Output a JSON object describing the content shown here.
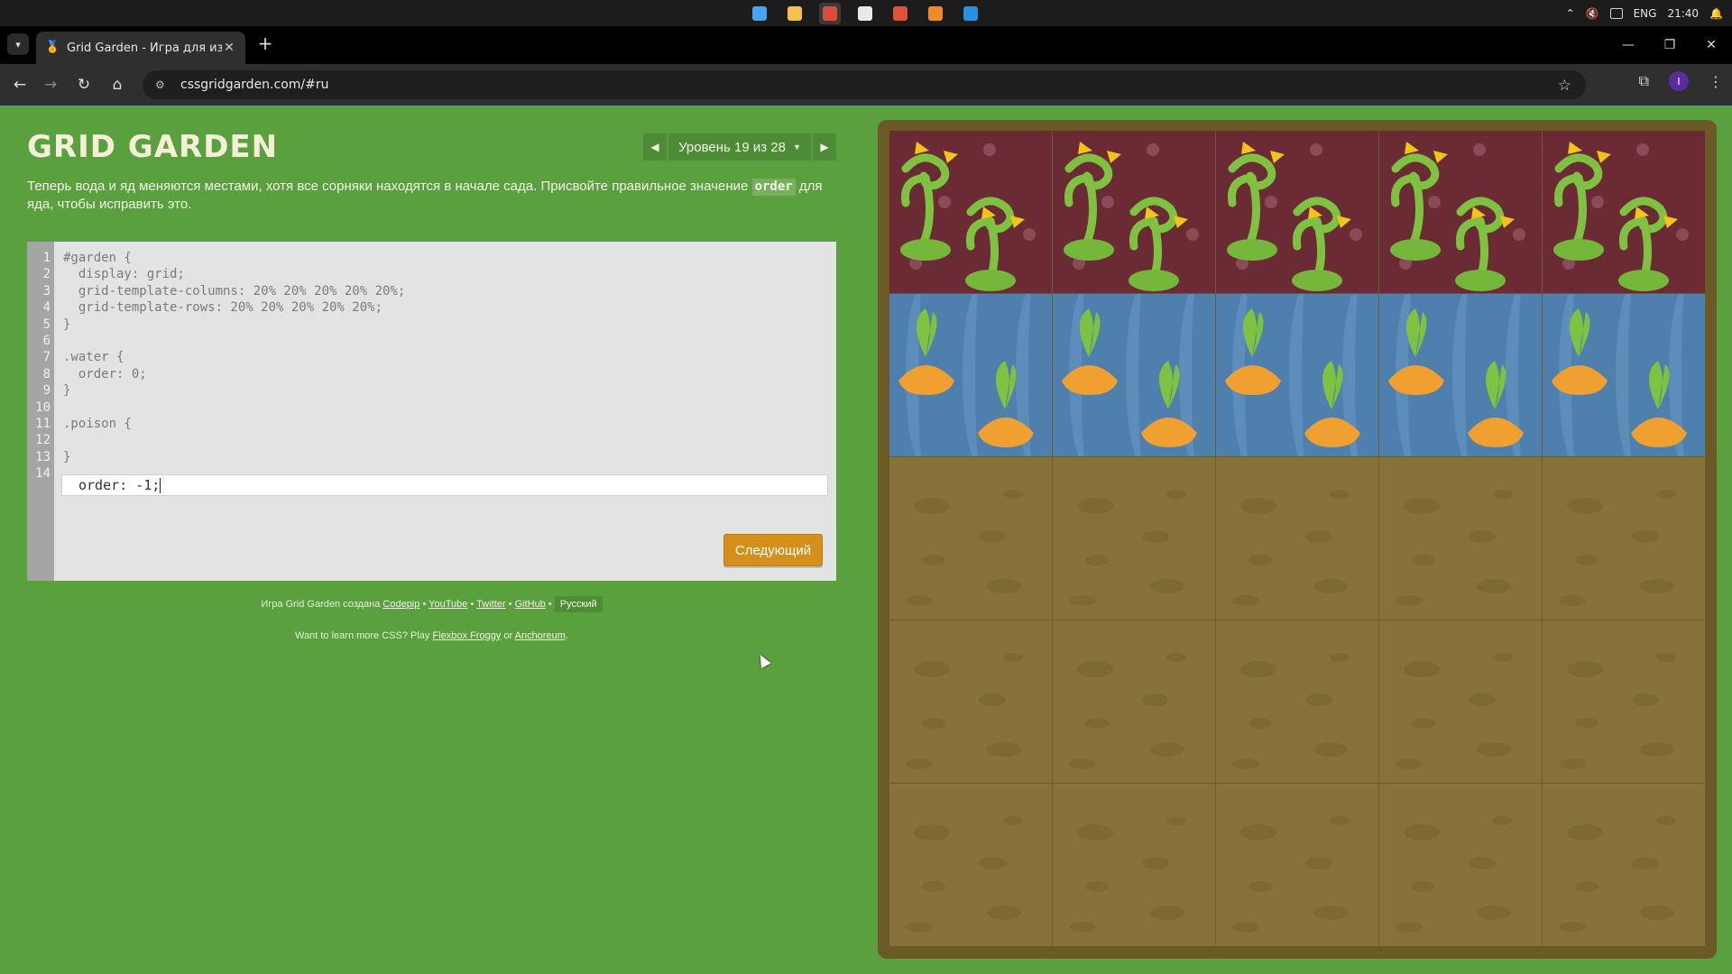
{
  "os": {
    "tray": {
      "lang": "ENG",
      "time": "21:40"
    },
    "apps": [
      {
        "icon": "windows-start-icon",
        "color": "#4aa3f0"
      },
      {
        "icon": "file-explorer-icon",
        "color": "#f2c24b"
      },
      {
        "icon": "chrome-icon",
        "color": "#dd4b3e"
      },
      {
        "icon": "app-shield-icon",
        "color": "#e8e8e8"
      },
      {
        "icon": "app-grid-icon",
        "color": "#e0513c"
      },
      {
        "icon": "sublime-text-icon",
        "color": "#f08a24"
      },
      {
        "icon": "vscode-icon",
        "color": "#2a8fdc"
      }
    ]
  },
  "browser": {
    "tab_title": "Grid Garden - Игра для изучен",
    "url": "cssgridgarden.com/#ru",
    "profile_initial": "I"
  },
  "page": {
    "title": "GRID GARDEN",
    "level_label": "Уровень 19 из 28",
    "instructions": {
      "before": "Теперь вода и яд меняются местами, хотя все сорняки находятся в начале сада. Присвойте правильное значение ",
      "keyword": "order",
      "after": " для яда, чтобы исправить это."
    },
    "code_lines": [
      "#garden {",
      "  display: grid;",
      "  grid-template-columns: 20% 20% 20% 20% 20%;",
      "  grid-template-rows: 20% 20% 20% 20% 20%;",
      "}",
      "",
      ".water {",
      "  order: 0;",
      "}",
      "",
      ".poison {",
      "",
      "}",
      ""
    ],
    "line_numbers": [
      "1",
      "2",
      "3",
      "4",
      "5",
      "6",
      "7",
      "8",
      "9",
      "10",
      "11",
      "12",
      "13",
      "14"
    ],
    "user_input": "order: -1;",
    "next_button": "Следующий",
    "credits": {
      "prefix": "Игра Grid Garden создана",
      "codepip": "Codepip",
      "youtube": "YouTube",
      "twitter": "Twitter",
      "github": "GitHub",
      "sep": "•",
      "language": "Русский"
    },
    "learn": {
      "prefix": "Want to learn more CSS? Play",
      "froggy": "Flexbox Froggy",
      "or": "or",
      "anchoreum": "Anchoreum",
      "suffix": "."
    }
  },
  "garden": {
    "columns": 5,
    "rows": 5,
    "row_types": [
      "poison",
      "water",
      "soil",
      "soil",
      "soil"
    ],
    "colors": {
      "soil": "#87733a",
      "poison": "#6b2b35",
      "water": "#4e7fad",
      "frame": "#6b5a26",
      "weed_green": "#7fc242",
      "carrot": "#f0a030"
    }
  }
}
